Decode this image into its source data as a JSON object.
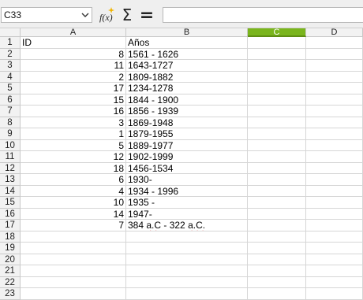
{
  "formula_bar": {
    "cell_reference": "C33",
    "function_wizard_label": "f(x)",
    "sum_symbol": "Σ",
    "equals_symbol": "=",
    "formula_value": ""
  },
  "sheet": {
    "columns": [
      "A",
      "B",
      "C",
      "D"
    ],
    "selected_column": "C",
    "row_numbers": [
      "1",
      "2",
      "3",
      "4",
      "5",
      "6",
      "7",
      "8",
      "9",
      "10",
      "11",
      "12",
      "13",
      "14",
      "15",
      "16",
      "17",
      "18",
      "19",
      "20",
      "21",
      "22",
      "23"
    ],
    "rows": [
      {
        "a": "ID",
        "b": "Años"
      },
      {
        "a": "8",
        "b": "1561 - 1626"
      },
      {
        "a": "11",
        "b": "1643-1727"
      },
      {
        "a": "2",
        "b": "1809-1882"
      },
      {
        "a": "17",
        "b": "1234-1278"
      },
      {
        "a": "15",
        "b": "1844 - 1900"
      },
      {
        "a": "16",
        "b": "1856 - 1939"
      },
      {
        "a": "3",
        "b": "1869-1948"
      },
      {
        "a": "1",
        "b": "1879-1955"
      },
      {
        "a": "5",
        "b": "1889-1977"
      },
      {
        "a": "12",
        "b": "1902-1999"
      },
      {
        "a": "18",
        "b": "1456-1534"
      },
      {
        "a": "6",
        "b": "1930-"
      },
      {
        "a": "4",
        "b": "1934 - 1996"
      },
      {
        "a": "10",
        "b": "1935 -"
      },
      {
        "a": "14",
        "b": "1947-"
      },
      {
        "a": "7",
        "b_parts": [
          "384 ",
          "a.C",
          " - 322 ",
          "a.C."
        ]
      }
    ]
  }
}
